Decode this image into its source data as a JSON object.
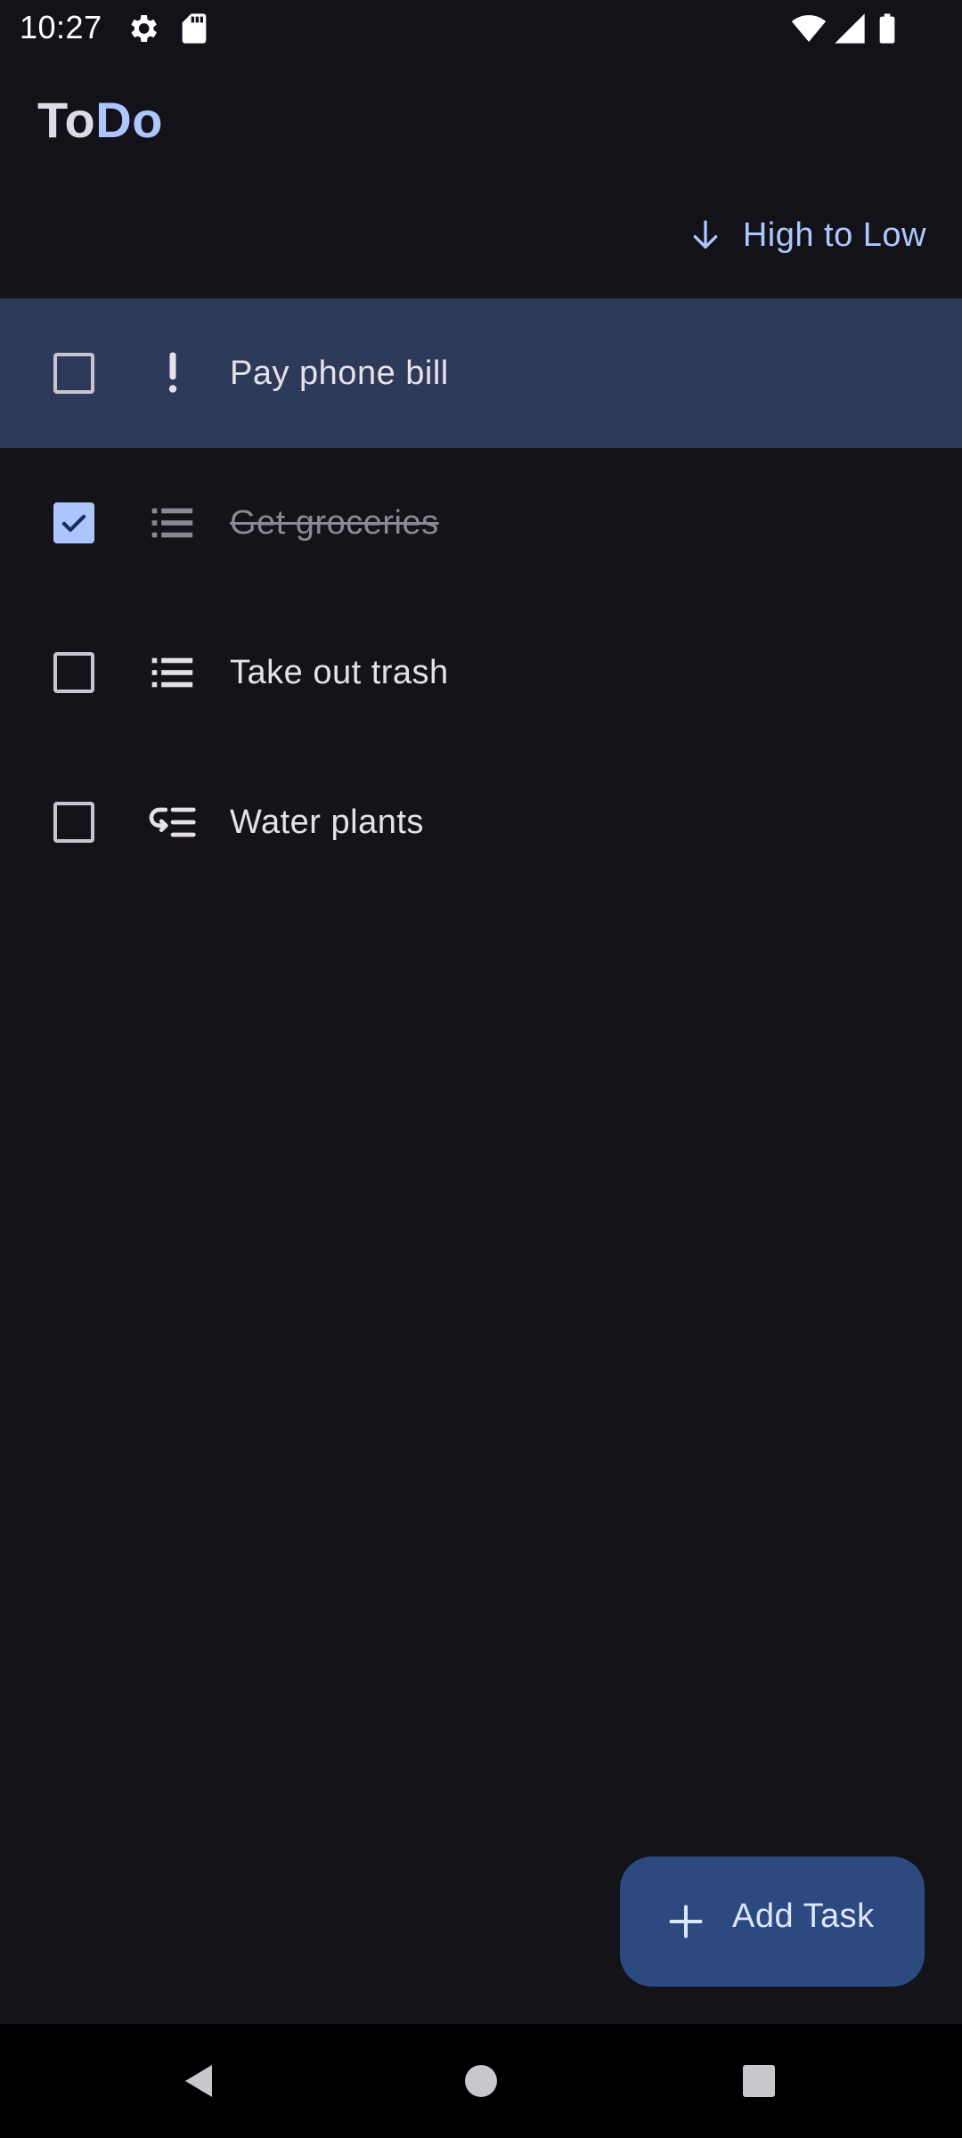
{
  "status_bar": {
    "time": "10:27",
    "icons": [
      "gear-icon",
      "sd-card-icon",
      "wifi-icon",
      "signal-icon",
      "battery-icon"
    ]
  },
  "app": {
    "title_part_1": "To",
    "title_part_2": "Do",
    "accent_color": "#aec6ff"
  },
  "sort": {
    "icon": "arrow-down-icon",
    "label": "High to Low"
  },
  "tasks": [
    {
      "title": "Pay phone bill",
      "checked": false,
      "priority_icon": "exclamation-icon",
      "selected": true
    },
    {
      "title": "Get groceries",
      "checked": true,
      "priority_icon": "list-icon",
      "selected": false
    },
    {
      "title": "Take out trash",
      "checked": false,
      "priority_icon": "list-icon",
      "selected": false
    },
    {
      "title": "Water plants",
      "checked": false,
      "priority_icon": "low-priority-list-icon",
      "selected": false
    }
  ],
  "fab": {
    "icon": "plus-icon",
    "label": "Add Task"
  },
  "nav_bar": {
    "buttons": [
      "back-icon",
      "home-icon",
      "recents-icon"
    ]
  }
}
